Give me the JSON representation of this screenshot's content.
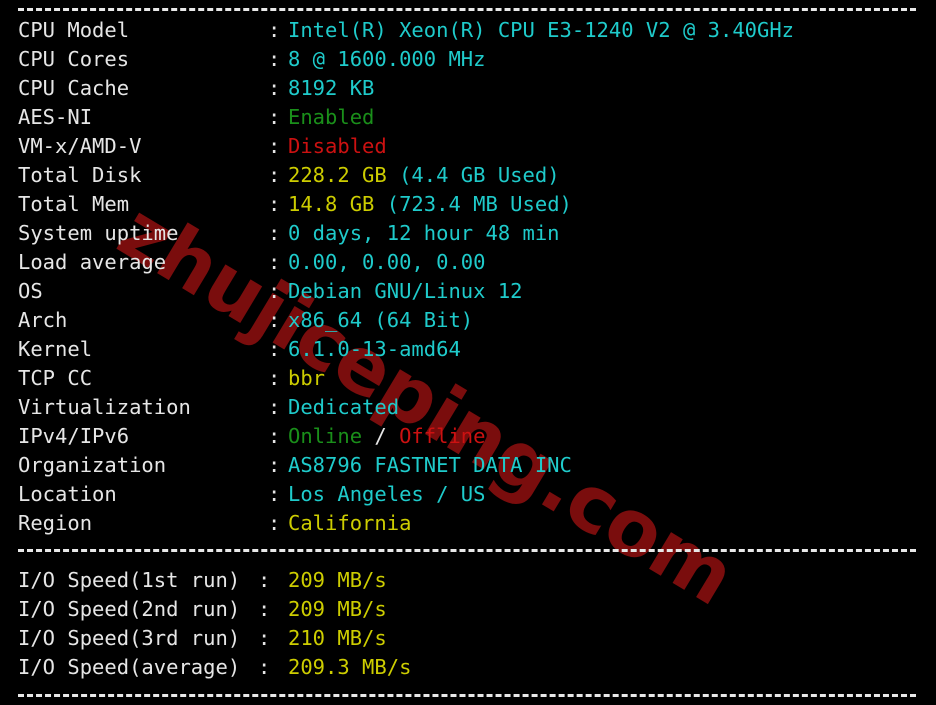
{
  "terminal": {
    "background": "#000000",
    "default_text_color": "#e6e6e6",
    "colors": {
      "cyan": "#1fcbcb",
      "yellow": "#cdcd00",
      "green": "#1a8f1a",
      "red": "#cc1111",
      "white": "#e6e6e6",
      "watermark_red": "#7a0d0d"
    },
    "separator": "-------------------------------------------------------------",
    "colon": ":"
  },
  "watermark": {
    "text": "zhujiceping.com"
  },
  "system_info": [
    {
      "label": "CPU Model",
      "value": "Intel(R) Xeon(R) CPU E3-1240 V2 @ 3.40GHz",
      "color": "cyan"
    },
    {
      "label": "CPU Cores",
      "value": "8 @ 1600.000 MHz",
      "color": "cyan"
    },
    {
      "label": "CPU Cache",
      "value": "8192 KB",
      "color": "cyan"
    },
    {
      "label": "AES-NI",
      "value": "Enabled",
      "color": "green"
    },
    {
      "label": "VM-x/AMD-V",
      "value": "Disabled",
      "color": "red"
    },
    {
      "label": "Total Disk",
      "value": "228.2 GB",
      "value_color": "yellow",
      "extra": " (4.4 GB Used)",
      "extra_color": "cyan"
    },
    {
      "label": "Total Mem",
      "value": "14.8 GB",
      "value_color": "yellow",
      "extra": " (723.4 MB Used)",
      "extra_color": "cyan"
    },
    {
      "label": "System uptime",
      "value": "0 days, 12 hour 48 min",
      "color": "cyan"
    },
    {
      "label": "Load average",
      "value": "0.00, 0.00, 0.00",
      "color": "cyan"
    },
    {
      "label": "OS",
      "value": "Debian GNU/Linux 12",
      "color": "cyan"
    },
    {
      "label": "Arch",
      "value": "x86_64 (64 Bit)",
      "color": "cyan"
    },
    {
      "label": "Kernel",
      "value": "6.1.0-13-amd64",
      "color": "cyan"
    },
    {
      "label": "TCP CC",
      "value": "bbr",
      "color": "yellow"
    },
    {
      "label": "Virtualization",
      "value": "Dedicated",
      "color": "cyan"
    },
    {
      "label": "IPv4/IPv6",
      "value": "Online",
      "value_color": "green",
      "mid": " / ",
      "mid_color": "white",
      "extra": "Offline",
      "extra_color": "red"
    },
    {
      "label": "Organization",
      "value": "AS8796 FASTNET DATA INC",
      "color": "cyan"
    },
    {
      "label": "Location",
      "value": "Los Angeles / US",
      "color": "cyan"
    },
    {
      "label": "Region",
      "value": "California",
      "color": "yellow"
    }
  ],
  "io_speed": [
    {
      "label": "I/O Speed(1st run)",
      "value": "209 MB/s",
      "color": "yellow"
    },
    {
      "label": "I/O Speed(2nd run)",
      "value": "209 MB/s",
      "color": "yellow"
    },
    {
      "label": "I/O Speed(3rd run)",
      "value": "210 MB/s",
      "color": "yellow"
    },
    {
      "label": "I/O Speed(average)",
      "value": "209.3 MB/s",
      "color": "yellow"
    }
  ]
}
